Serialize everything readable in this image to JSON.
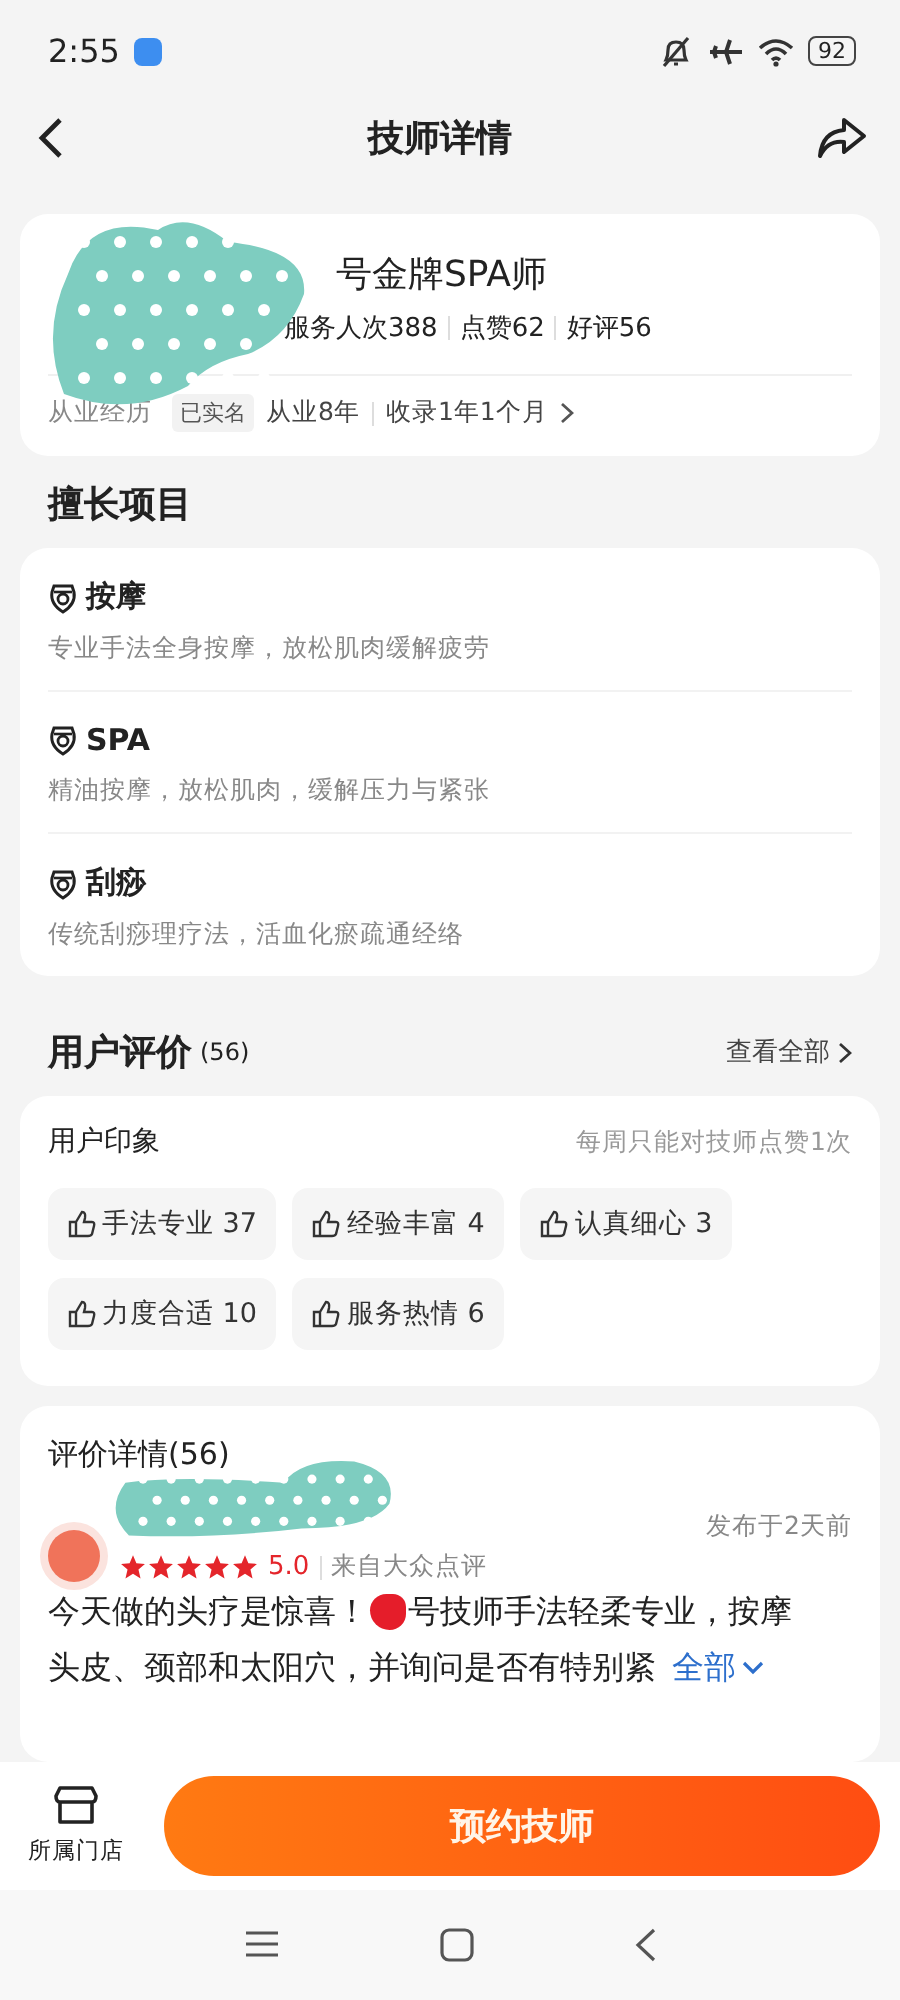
{
  "status_bar": {
    "time": "2:55",
    "battery": "92"
  },
  "header": {
    "title": "技师详情"
  },
  "profile": {
    "name": "号金牌SPA师",
    "stats": [
      "服务人次388",
      "点赞62",
      "好评56"
    ],
    "experience_label": "从业经历",
    "verified_badge": "已实名",
    "years": "从业8年",
    "listed": "收录1年1个月"
  },
  "skills": {
    "title": "擅长项目",
    "items": [
      {
        "name": "按摩",
        "description": "专业手法全身按摩，放松肌肉缓解疲劳"
      },
      {
        "name": "SPA",
        "description": "精油按摩，放松肌肉，缓解压力与紧张"
      },
      {
        "name": "刮痧",
        "description": "传统刮痧理疗法，活血化瘀疏通经络"
      }
    ]
  },
  "reviews": {
    "title": "用户评价",
    "count": "(56)",
    "view_all": "查看全部",
    "impressions": {
      "title": "用户印象",
      "hint": "每周只能对技师点赞1次",
      "tags": [
        {
          "label": "手法专业 37"
        },
        {
          "label": "经验丰富 4"
        },
        {
          "label": "认真细心 3"
        },
        {
          "label": "力度合适 10"
        },
        {
          "label": "服务热情 6"
        }
      ]
    },
    "detail": {
      "title": "评价详情(56)",
      "posted": "发布于2天前",
      "stars": 5,
      "score": "5.0",
      "source": "来自大众点评",
      "text_start": "今天做的头疗是惊喜！",
      "text_middle": "号技师手法轻柔专业，按摩",
      "text_end": "头皮、颈部和太阳穴，并询问是否有特别紧",
      "expand": "全部"
    }
  },
  "bottom_bar": {
    "store_label": "所属门店",
    "book_button": "预约技师"
  }
}
